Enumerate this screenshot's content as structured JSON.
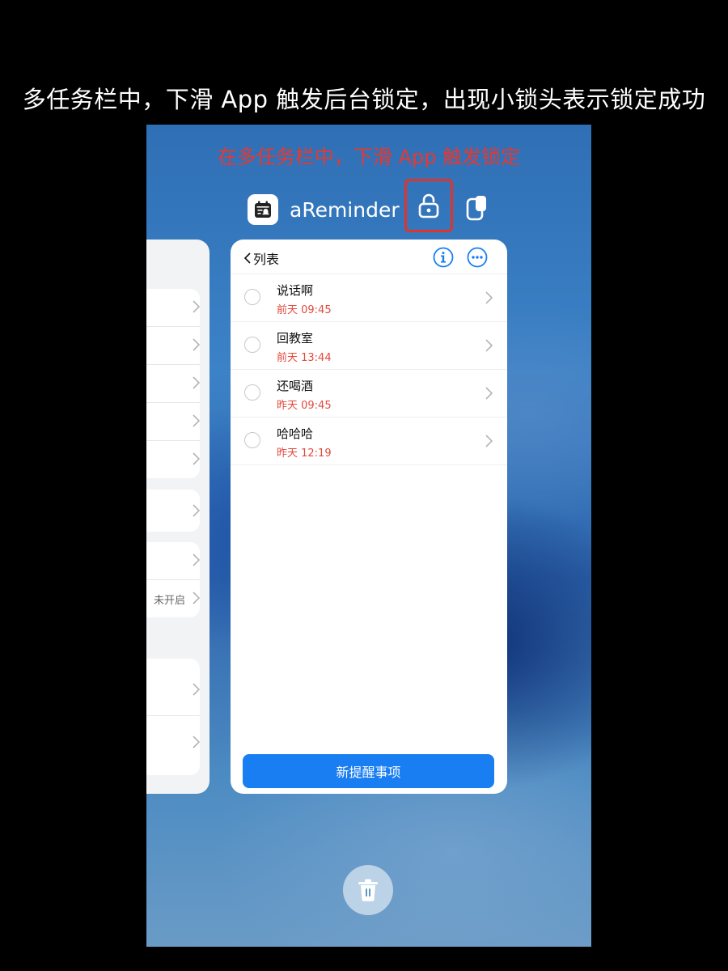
{
  "caption": "多任务栏中，下滑 App 触发后台锁定，出现小锁头表示锁定成功",
  "hint": "在多任务栏中，下滑 App 触发锁定",
  "app": {
    "name": "aReminder"
  },
  "icons": {
    "app": "calendar-reminder-icon",
    "lock": "lock-icon",
    "multi_window": "multi-window-icon",
    "info": "info-icon",
    "more": "more-icon",
    "trash": "trash-icon"
  },
  "left_card": {
    "status_text": "未开启"
  },
  "list": {
    "back_label": "列表",
    "items": [
      {
        "title": "说话啊",
        "time": "前天 09:45"
      },
      {
        "title": "回教室",
        "time": "前天 13:44"
      },
      {
        "title": "还喝酒",
        "time": "昨天 09:45"
      },
      {
        "title": "哈哈哈",
        "time": "昨天 12:19"
      }
    ],
    "new_button": "新提醒事项"
  },
  "colors": {
    "accent_blue": "#1a7ef3",
    "highlight_red": "#e0342a",
    "time_red": "#e3483c"
  }
}
